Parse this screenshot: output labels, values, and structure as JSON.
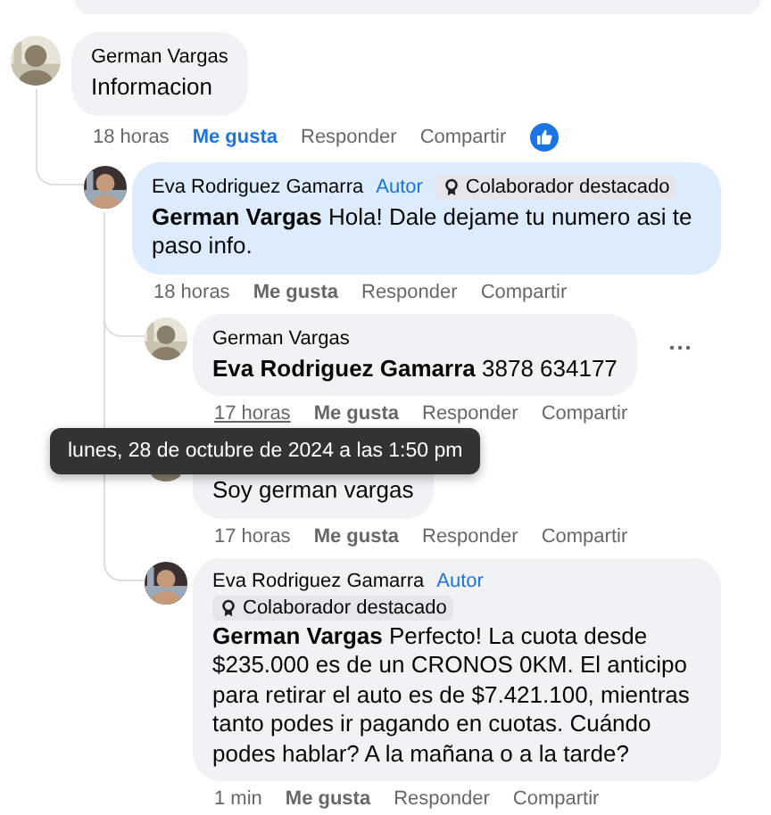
{
  "comments": [
    {
      "author": "German Vargas",
      "text": "Informacion",
      "time": "18 horas",
      "like_label": "Me gusta",
      "liked": true,
      "reply_label": "Responder",
      "share_label": "Compartir",
      "reacted": true,
      "children": [
        {
          "author": "Eva Rodriguez Gamarra",
          "badges": [
            {
              "kind": "author",
              "label": "Autor"
            },
            {
              "kind": "top_contributor",
              "label": "Colaborador destacado"
            }
          ],
          "highlighted": true,
          "text": "**German Vargas** Hola! Dale dejame tu numero asi te paso info.",
          "time": "18 horas",
          "like_label": "Me gusta",
          "liked": false,
          "reply_label": "Responder",
          "share_label": "Compartir",
          "children": [
            {
              "author": "German Vargas",
              "text": "**Eva Rodriguez Gamarra** 3878 634177",
              "more_menu": true,
              "time": "17 horas",
              "time_hovered": true,
              "tooltip": "lunes, 28 de octubre de 2024 a las 1:50 pm",
              "like_label": "Me gusta",
              "liked": false,
              "reply_label": "Responder",
              "share_label": "Compartir"
            },
            {
              "text": "Soy german vargas",
              "time": "17 horas",
              "like_label": "Me gusta",
              "liked": false,
              "reply_label": "Responder",
              "share_label": "Compartir"
            },
            {
              "author": "Eva Rodriguez Gamarra",
              "badges": [
                {
                  "kind": "author",
                  "label": "Autor"
                },
                {
                  "kind": "top_contributor",
                  "label": "Colaborador destacado"
                }
              ],
              "text": "**German Vargas** Perfecto! La cuota desde $235.000 es de un CRONOS 0KM. El anticipo para retirar el auto es de $7.421.100, mientras tanto podes ir pagando en cuotas. Cuándo podes hablar? A la mañana o a la tarde?",
              "time": "1 min",
              "like_label": "Me gusta",
              "liked": false,
              "reply_label": "Responder",
              "share_label": "Compartir"
            }
          ]
        }
      ]
    }
  ]
}
